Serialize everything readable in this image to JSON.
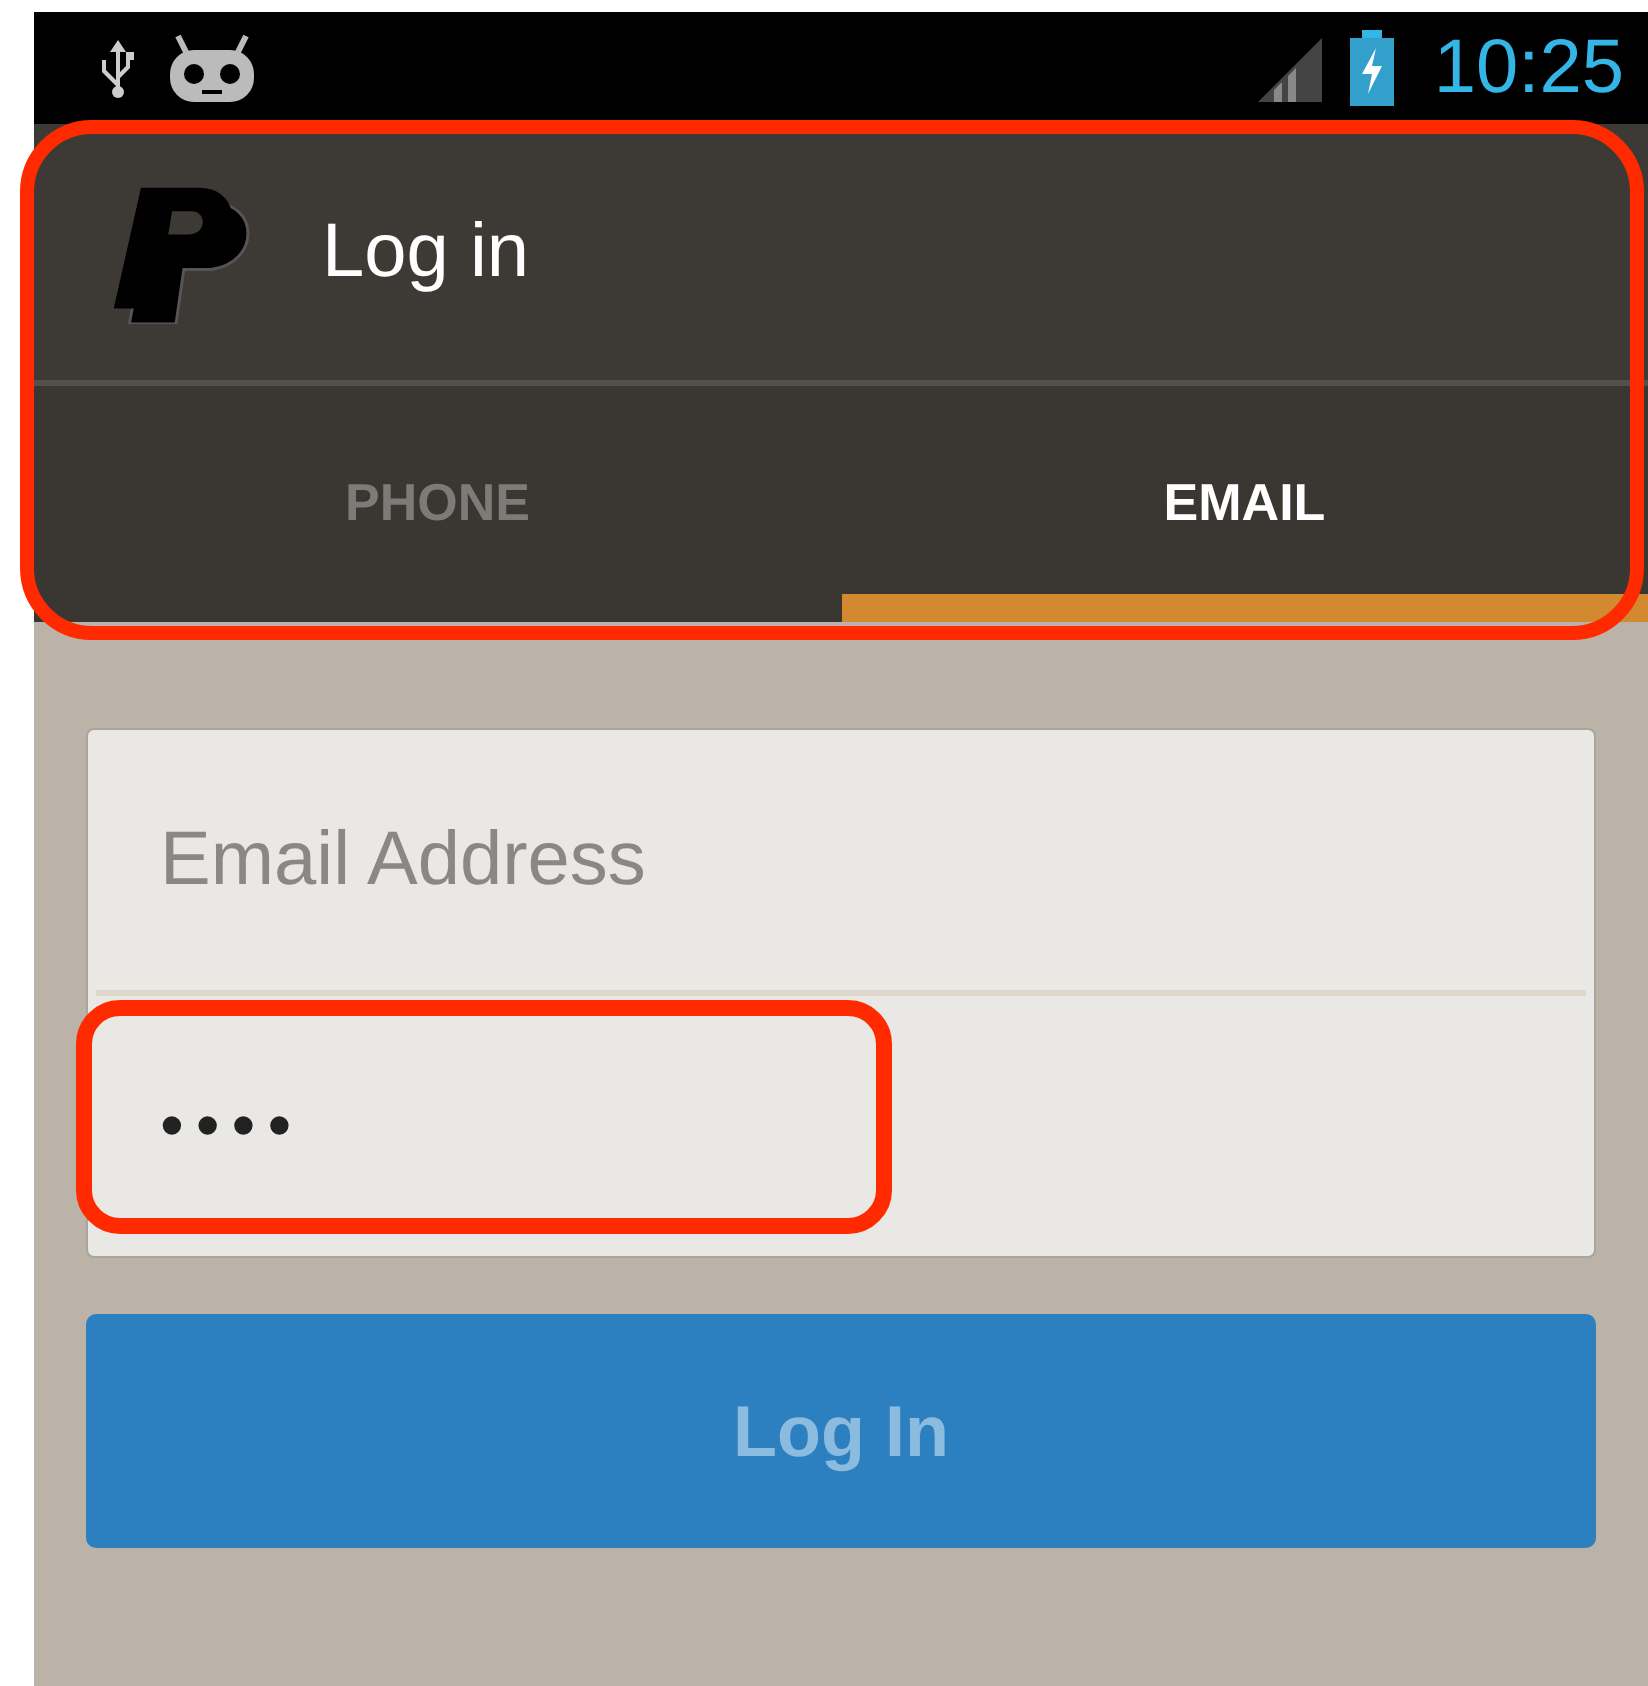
{
  "status_bar": {
    "time": "10:25"
  },
  "header": {
    "title": "Log in",
    "highlighted": true
  },
  "tabs": [
    {
      "label": "PHONE",
      "selected": false
    },
    {
      "label": "EMAIL",
      "selected": true
    }
  ],
  "email_field": {
    "placeholder": "Email Address"
  },
  "password_field": {
    "value": "••••",
    "highlighted": true
  },
  "login_button": {
    "label": "Log In",
    "disabled": true
  }
}
